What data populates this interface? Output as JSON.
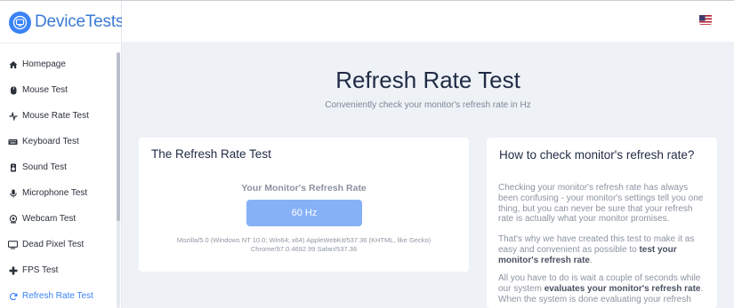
{
  "brand": {
    "name": "DeviceTests",
    "accent": "#3b82f6"
  },
  "nav": {
    "items": [
      {
        "label": "Homepage",
        "icon": "home-icon"
      },
      {
        "label": "Mouse Test",
        "icon": "mouse-icon"
      },
      {
        "label": "Mouse Rate Test",
        "icon": "pulse-icon"
      },
      {
        "label": "Keyboard Test",
        "icon": "keyboard-icon"
      },
      {
        "label": "Sound Test",
        "icon": "speaker-icon"
      },
      {
        "label": "Microphone Test",
        "icon": "microphone-icon"
      },
      {
        "label": "Webcam Test",
        "icon": "webcam-icon"
      },
      {
        "label": "Dead Pixel Test",
        "icon": "monitor-icon"
      },
      {
        "label": "FPS Test",
        "icon": "gamepad-icon"
      },
      {
        "label": "Refresh Rate Test",
        "icon": "refresh-icon",
        "active": true
      }
    ]
  },
  "header": {
    "language_flag": "us-flag-icon"
  },
  "main": {
    "title": "Refresh Rate Test",
    "subtitle": "Conveniently check your monitor's refresh rate in Hz"
  },
  "test_card": {
    "title": "The Refresh Rate Test",
    "rate_label": "Your Monitor's Refresh Rate",
    "rate_value": "60 Hz",
    "user_agent_line1": "Mozilla/5.0 (Windows NT 10.0; Win64; x64) AppleWebKit/537.36 (KHTML, like Gecko)",
    "user_agent_line2": "Chrome/97.0.4692.99 Safari/537.36"
  },
  "howto_card": {
    "title": "How to check monitor's refresh rate?",
    "p1": "Checking your monitor's refresh rate has always been confusing - your monitor's settings tell you one thing, but you can never be sure that your refresh rate is actually what your monitor promises.",
    "p2_pre": "That's why we have created this test to make it as easy and convenient as possible to ",
    "p2_bold": "test your monitor's refresh rate",
    "p2_post": ".",
    "p3_pre": "All you have to do is wait a couple of seconds while our system ",
    "p3_bold": "evaluates your monitor's refresh rate",
    "p3_post": ". When the system is done evaluating your refresh"
  }
}
